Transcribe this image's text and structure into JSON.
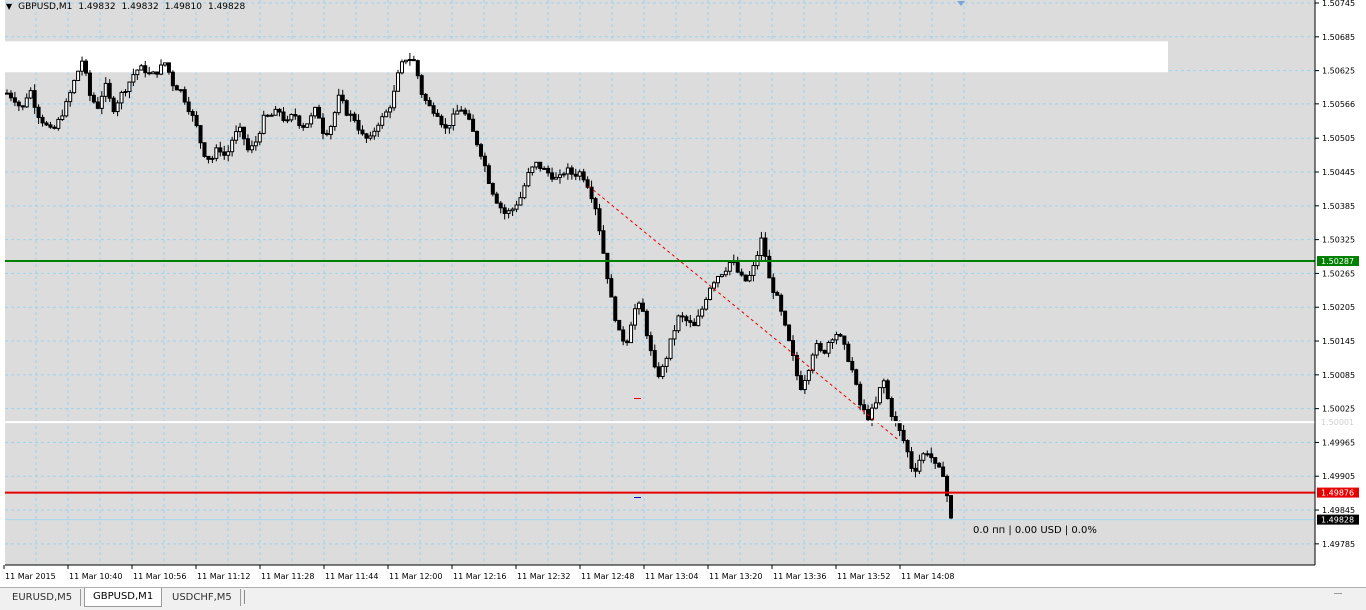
{
  "chart_header": {
    "symbol": "GBPUSD,M1",
    "open": "1.49832",
    "high": "1.49832",
    "low": "1.49810",
    "close": "1.49828"
  },
  "pnl_label": "0.0 пп | 0.00 USD | 0.0%",
  "tabs": [
    {
      "label": "EURUSD,M5",
      "active": false
    },
    {
      "label": "GBPUSD,M1",
      "active": true
    },
    {
      "label": "USDCHF,M5",
      "active": false
    }
  ],
  "colors": {
    "background": "#ffffff",
    "plot_bg": "#dcdcdc",
    "grid": "#9bd2f0",
    "candle": "#000000",
    "green_line": "#008000",
    "red_line": "#e60000",
    "white_line": "#ffffff",
    "trend_line": "#e60000",
    "current_price_tag": "#000000"
  },
  "chart_data": {
    "type": "candlestick",
    "title": "GBPUSD,M1",
    "ylim": [
      1.49751,
      1.50745
    ],
    "y_ticks": [
      "1.50745",
      "1.50685",
      "1.50625",
      "1.50566",
      "1.50505",
      "1.50445",
      "1.50385",
      "1.50325",
      "1.50265",
      "1.50205",
      "1.50145",
      "1.50085",
      "1.50025",
      "1.49965",
      "1.49905",
      "1.49845",
      "1.49785"
    ],
    "x_ticks": [
      "11 Mar 2015",
      "11 Mar 10:40",
      "11 Mar 10:56",
      "11 Mar 11:12",
      "11 Mar 11:28",
      "11 Mar 11:44",
      "11 Mar 12:00",
      "11 Mar 12:16",
      "11 Mar 12:32",
      "11 Mar 12:48",
      "11 Mar 13:04",
      "11 Mar 13:20",
      "11 Mar 13:36",
      "11 Mar 13:52",
      "11 Mar 14:08"
    ],
    "grid": true,
    "close_path": [
      [
        0,
        1.50585
      ],
      [
        6,
        1.50575
      ],
      [
        12,
        1.50555
      ],
      [
        18,
        1.50595
      ],
      [
        24,
        1.5055
      ],
      [
        30,
        1.5053
      ],
      [
        36,
        1.50515
      ],
      [
        42,
        1.5054
      ],
      [
        48,
        1.5057
      ],
      [
        54,
        1.5061
      ],
      [
        60,
        1.50645
      ],
      [
        66,
        1.5058
      ],
      [
        72,
        1.5056
      ],
      [
        78,
        1.506
      ],
      [
        84,
        1.50555
      ],
      [
        90,
        1.5058
      ],
      [
        96,
        1.506
      ],
      [
        102,
        1.50625
      ],
      [
        108,
        1.5063
      ],
      [
        114,
        1.50615
      ],
      [
        120,
        1.50625
      ],
      [
        126,
        1.5064
      ],
      [
        132,
        1.506
      ],
      [
        138,
        1.5059
      ],
      [
        144,
        1.5056
      ],
      [
        150,
        1.5053
      ],
      [
        156,
        1.5048
      ],
      [
        162,
        1.50465
      ],
      [
        168,
        1.5049
      ],
      [
        174,
        1.5047
      ],
      [
        180,
        1.5051
      ],
      [
        186,
        1.5052
      ],
      [
        192,
        1.5048
      ],
      [
        198,
        1.505
      ],
      [
        204,
        1.5054
      ],
      [
        210,
        1.50545
      ],
      [
        216,
        1.50555
      ],
      [
        222,
        1.5053
      ],
      [
        228,
        1.5055
      ],
      [
        234,
        1.50525
      ],
      [
        240,
        1.50535
      ],
      [
        246,
        1.5056
      ],
      [
        252,
        1.5051
      ],
      [
        258,
        1.5053
      ],
      [
        264,
        1.5058
      ],
      [
        270,
        1.5055
      ],
      [
        276,
        1.5054
      ],
      [
        282,
        1.5051
      ],
      [
        288,
        1.505
      ],
      [
        294,
        1.5053
      ],
      [
        300,
        1.50545
      ],
      [
        306,
        1.5057
      ],
      [
        312,
        1.5063
      ],
      [
        318,
        1.5065
      ],
      [
        324,
        1.5064
      ],
      [
        330,
        1.5058
      ],
      [
        336,
        1.5056
      ],
      [
        342,
        1.5055
      ],
      [
        348,
        1.5052
      ],
      [
        354,
        1.5054
      ],
      [
        360,
        1.5056
      ],
      [
        366,
        1.5054
      ],
      [
        372,
        1.50505
      ],
      [
        378,
        1.5047
      ],
      [
        384,
        1.5042
      ],
      [
        390,
        1.5039
      ],
      [
        396,
        1.5037
      ],
      [
        402,
        1.5038
      ],
      [
        408,
        1.504
      ],
      [
        414,
        1.5044
      ],
      [
        420,
        1.5046
      ],
      [
        426,
        1.5045
      ],
      [
        432,
        1.5044
      ],
      [
        438,
        1.5043
      ],
      [
        444,
        1.5045
      ],
      [
        450,
        1.5044
      ],
      [
        456,
        1.50445
      ],
      [
        462,
        1.5042
      ],
      [
        468,
        1.5038
      ],
      [
        474,
        1.503
      ],
      [
        480,
        1.5022
      ],
      [
        486,
        1.5016
      ],
      [
        492,
        1.5014
      ],
      [
        498,
        1.502
      ],
      [
        504,
        1.5021
      ],
      [
        510,
        1.5014
      ],
      [
        516,
        1.5008
      ],
      [
        522,
        1.501
      ],
      [
        528,
        1.5015
      ],
      [
        534,
        1.5019
      ],
      [
        540,
        1.5018
      ],
      [
        546,
        1.5017
      ],
      [
        552,
        1.502
      ],
      [
        558,
        1.5024
      ],
      [
        564,
        1.5026
      ],
      [
        570,
        1.5027
      ],
      [
        576,
        1.5029
      ],
      [
        582,
        1.5026
      ],
      [
        588,
        1.5025
      ],
      [
        594,
        1.5028
      ],
      [
        600,
        1.5033
      ],
      [
        606,
        1.5025
      ],
      [
        612,
        1.5022
      ],
      [
        618,
        1.5017
      ],
      [
        624,
        1.5012
      ],
      [
        630,
        1.5006
      ],
      [
        636,
        1.5009
      ],
      [
        642,
        1.5014
      ],
      [
        648,
        1.5012
      ],
      [
        654,
        1.5015
      ],
      [
        660,
        1.5016
      ],
      [
        666,
        1.5013
      ],
      [
        672,
        1.5009
      ],
      [
        678,
        1.5003
      ],
      [
        684,
        1.5001
      ],
      [
        690,
        1.5003
      ],
      [
        696,
        1.5008
      ],
      [
        702,
        1.5002
      ],
      [
        708,
        1.4999
      ],
      [
        714,
        1.4996
      ],
      [
        720,
        1.4991
      ],
      [
        726,
        1.4994
      ],
      [
        732,
        1.4995
      ],
      [
        738,
        1.4992
      ],
      [
        744,
        1.4991
      ],
      [
        750,
        1.49828
      ]
    ],
    "horizontal_lines": [
      {
        "price": 1.50287,
        "label": "1.50287",
        "color": "#008000"
      },
      {
        "price": 1.50001,
        "label": "1.50001",
        "color": "#ffffff"
      },
      {
        "price": 1.49876,
        "label": "1.49876",
        "color": "#e60000"
      }
    ],
    "current_price": {
      "price": 1.49828,
      "label": "1.49828"
    },
    "trendline": {
      "from": [
        1.5042,
        462
      ],
      "to": [
        1.4997,
        708
      ]
    },
    "highlight_band": {
      "top": 1.50677,
      "bottom": 1.50622
    }
  }
}
